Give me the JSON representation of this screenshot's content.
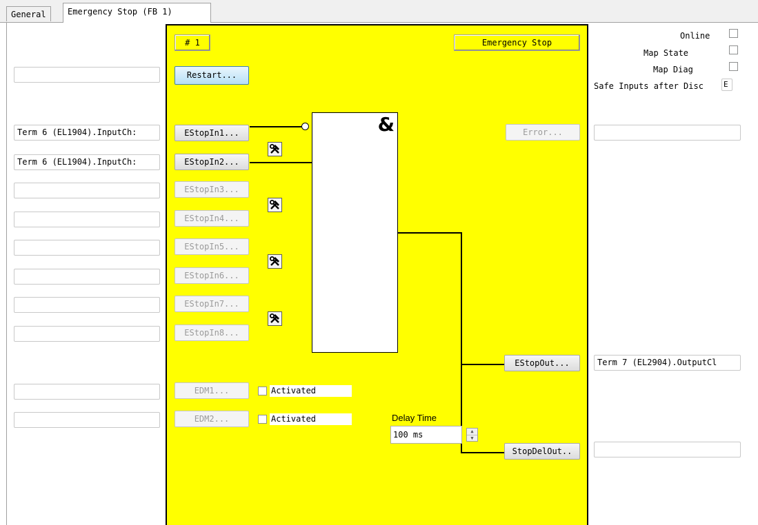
{
  "tabs": [
    {
      "label": "General",
      "active": false
    },
    {
      "label": "Emergency Stop (FB 1)",
      "active": true
    }
  ],
  "block": {
    "number_label": "# 1",
    "title": "Emergency Stop",
    "restart_label": "Restart...",
    "error_label": "Error...",
    "and_symbol": "&",
    "accent_color": "#ffff00"
  },
  "inputs": [
    {
      "button": "EStopIn1...",
      "mapping": "Term 6 (EL1904).InputCh:",
      "enabled": true
    },
    {
      "button": "EStopIn2...",
      "mapping": "Term 6 (EL1904).InputCh:",
      "enabled": true
    },
    {
      "button": "EStopIn3...",
      "mapping": "",
      "enabled": false
    },
    {
      "button": "EStopIn4...",
      "mapping": "",
      "enabled": false
    },
    {
      "button": "EStopIn5...",
      "mapping": "",
      "enabled": false
    },
    {
      "button": "EStopIn6...",
      "mapping": "",
      "enabled": false
    },
    {
      "button": "EStopIn7...",
      "mapping": "",
      "enabled": false
    },
    {
      "button": "EStopIn8...",
      "mapping": "",
      "enabled": false
    }
  ],
  "edm": [
    {
      "button": "EDM1...",
      "checkbox_label": "Activated",
      "checked": false,
      "mapping": ""
    },
    {
      "button": "EDM2...",
      "checkbox_label": "Activated",
      "checked": false,
      "mapping": ""
    }
  ],
  "outputs": {
    "estop_out_label": "EStopOut...",
    "estop_out_mapping": "Term 7 (EL2904).OutputCl",
    "stopdel_out_label": "StopDelOut..",
    "stopdel_out_mapping": "",
    "error_mapping": ""
  },
  "delay": {
    "label": "Delay Time",
    "value": "100 ms"
  },
  "options": {
    "online_label": "Online",
    "map_state_label": "Map State",
    "map_diag_label": "Map Diag",
    "safe_inputs_label": "Safe Inputs after Disc",
    "safe_inputs_value": "E"
  },
  "restart_mapping": ""
}
